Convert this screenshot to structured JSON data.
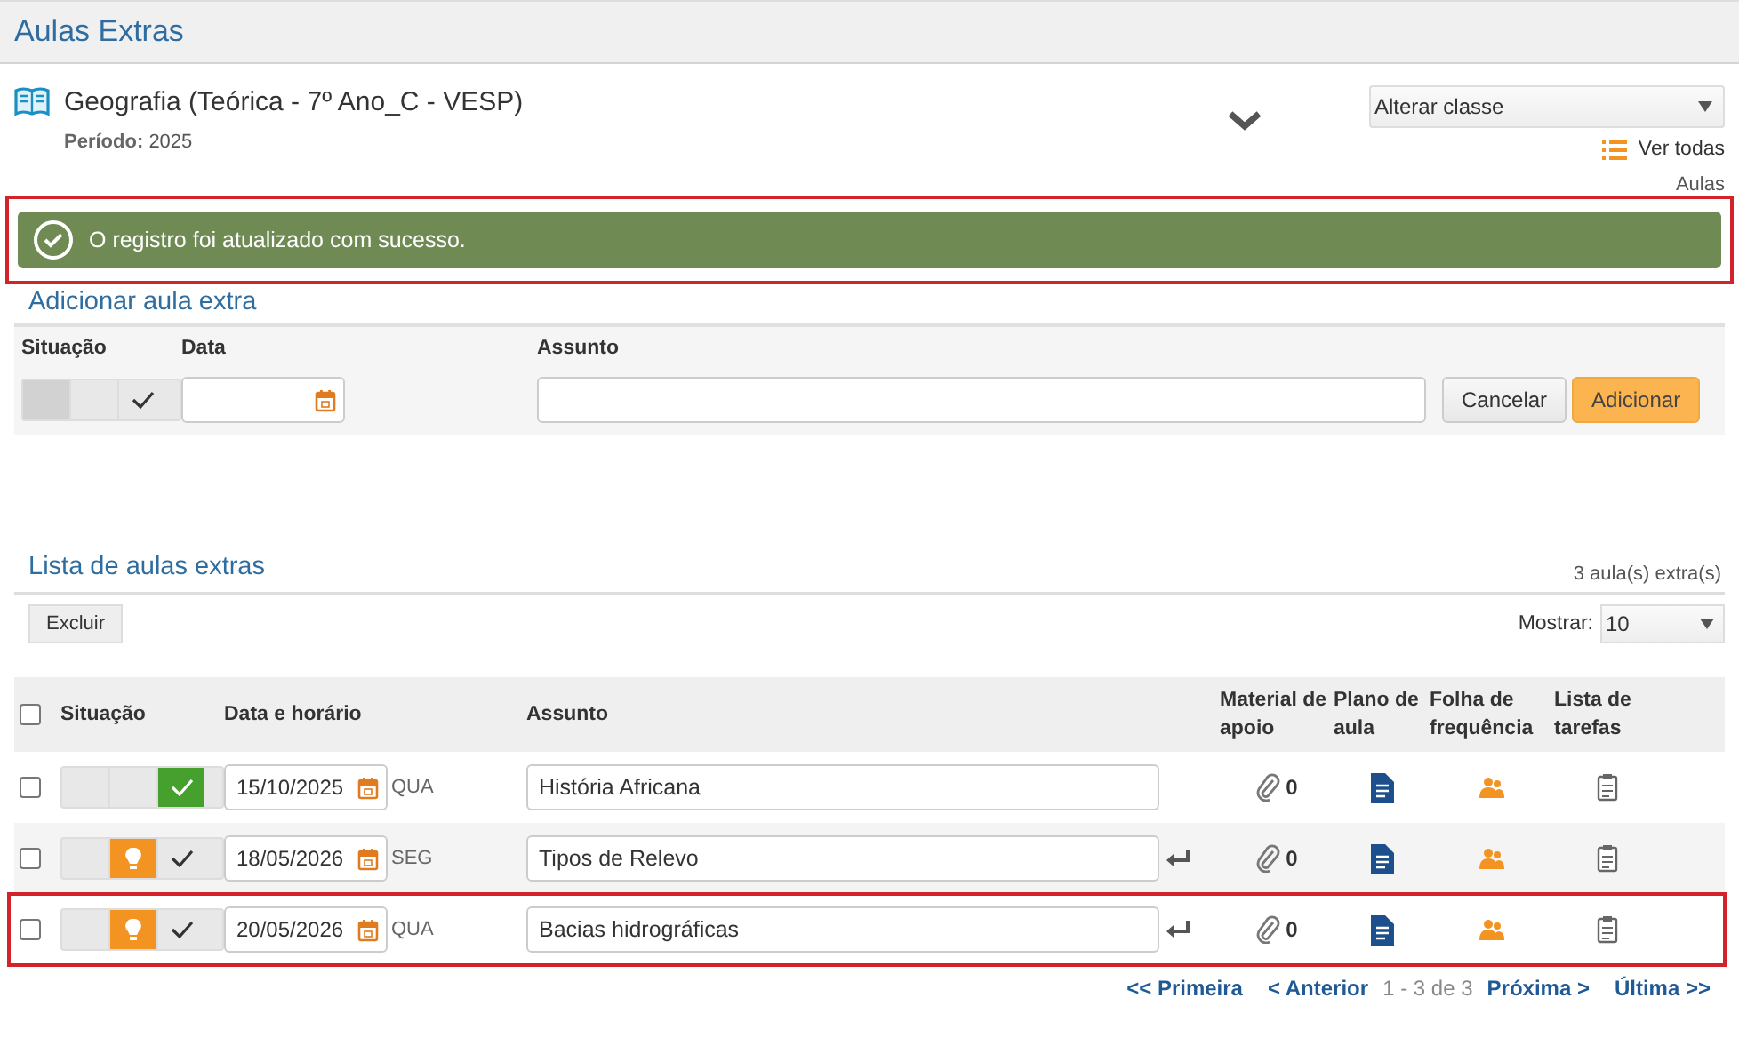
{
  "page_title": "Aulas Extras",
  "class_info": {
    "name": "Geografia (Teórica - 7º Ano_C - VESP)",
    "period_label": "Período:",
    "period": "2025"
  },
  "class_select": {
    "value": "Alterar classe"
  },
  "see_all": {
    "label": "Ver todas",
    "sublabel": "Aulas"
  },
  "alert": {
    "message": "O registro foi atualizado com sucesso.",
    "highlighted": true
  },
  "add_form": {
    "title": "Adicionar aula extra",
    "labels": [
      "Situação",
      "Data",
      "Assunto"
    ],
    "done": false,
    "planned": false,
    "buttons": [
      "Cancelar",
      "Adicionar"
    ]
  },
  "list": {
    "title": "Lista de aulas extras",
    "count": "3 aula(s) extra(s)",
    "delete_button": "Excluir",
    "show_label": "Mostrar:",
    "show_value": "10",
    "select_all_checked": false,
    "columns": [
      "Situação",
      "Data e horário",
      "Assunto",
      "Material de apoio",
      "Plano de aula",
      "Folha de frequência",
      "Lista de tarefas"
    ],
    "rows": [
      {
        "checked": false,
        "done": true,
        "planned": false,
        "date": "15/10/2025",
        "weekday": "QUA",
        "subject": "História Africana",
        "enter_icon": false,
        "materials": "0",
        "highlighted": false
      },
      {
        "checked": false,
        "done": false,
        "planned": true,
        "date": "18/05/2026",
        "weekday": "SEG",
        "subject": "Tipos de Relevo",
        "enter_icon": true,
        "materials": "0",
        "highlighted": false
      },
      {
        "checked": false,
        "done": false,
        "planned": true,
        "date": "20/05/2026",
        "weekday": "QUA",
        "subject": "Bacias hidrográficas",
        "enter_icon": true,
        "materials": "0",
        "highlighted": true
      }
    ]
  },
  "pagination": {
    "first": "<< Primeira",
    "prev": "< Anterior",
    "info": "1 - 3 de 3",
    "next": "Próxima >",
    "last": "Última >>"
  }
}
